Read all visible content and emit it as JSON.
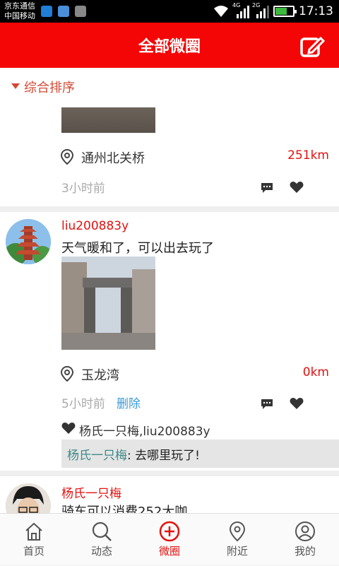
{
  "status_bar": {
    "carrier_1": "京东通信",
    "carrier_2": "中国移动",
    "net_4g": "4G",
    "net_2g": "2G",
    "time": "17:13"
  },
  "header": {
    "title": "全部微圈"
  },
  "sort": {
    "label": "综合排序"
  },
  "posts": [
    {
      "location": "通州北关桥",
      "distance": "251km",
      "time": "3小时前"
    },
    {
      "username": "liu200883y",
      "content": "天气暖和了，可以出去玩了",
      "location": "玉龙湾",
      "distance": "0km",
      "time": "5小时前",
      "delete_label": "删除",
      "likes": "杨氏一只梅,liu200883y",
      "comment_name": "杨氏一只梅",
      "comment_text": ": 去哪里玩了!"
    },
    {
      "username": "杨氏一只梅",
      "content": "骑车可以消费252大咖"
    }
  ],
  "tabs": [
    {
      "label": "首页",
      "icon": "home-icon"
    },
    {
      "label": "动态",
      "icon": "search-icon"
    },
    {
      "label": "微圈",
      "icon": "plus-circle-icon",
      "active": true
    },
    {
      "label": "附近",
      "icon": "location-icon"
    },
    {
      "label": "我的",
      "icon": "user-icon"
    }
  ],
  "colors": {
    "accent": "#f50606",
    "username": "#e3110f",
    "delete_link": "#3a9bd9",
    "comment_name": "#3d8a88"
  }
}
